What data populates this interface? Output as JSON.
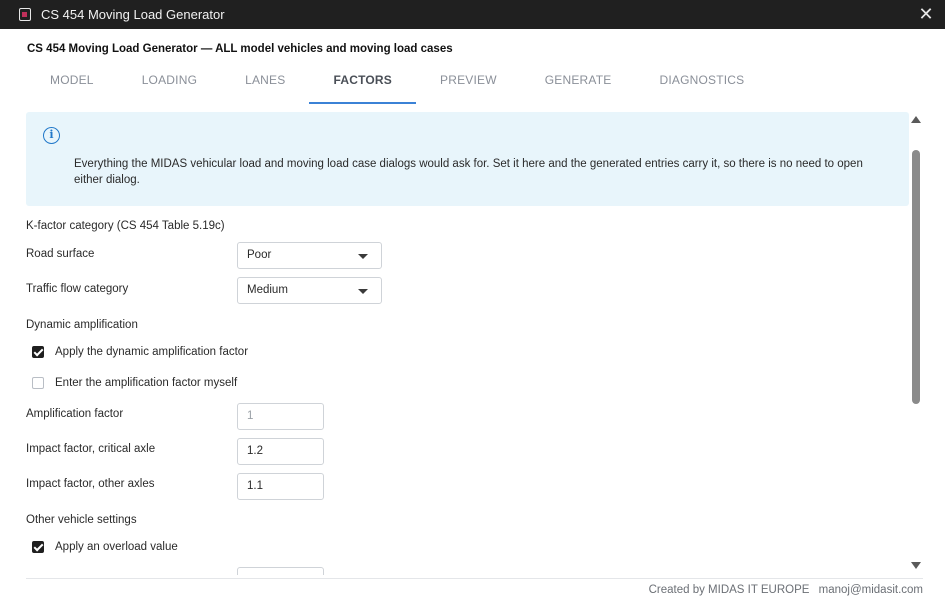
{
  "window": {
    "title": "CS 454 Moving Load Generator"
  },
  "page": {
    "heading": "CS 454 Moving Load Generator — ALL model vehicles and moving load cases"
  },
  "tabs": [
    {
      "label": "MODEL"
    },
    {
      "label": "LOADING"
    },
    {
      "label": "LANES"
    },
    {
      "label": "FACTORS"
    },
    {
      "label": "PREVIEW"
    },
    {
      "label": "GENERATE"
    },
    {
      "label": "DIAGNOSTICS"
    }
  ],
  "active_tab": "FACTORS",
  "info": {
    "icon": "info-circle-icon",
    "text": "Everything the MIDAS vehicular load and moving load case dialogs would ask for. Set it here and the generated entries carry it, so there is no need to open either dialog."
  },
  "kfactor": {
    "heading": "K-factor category (CS 454 Table 5.19c)",
    "road_surface": {
      "label": "Road surface",
      "value": "Poor"
    },
    "traffic_flow": {
      "label": "Traffic flow category",
      "value": "Medium"
    }
  },
  "dynamic": {
    "heading": "Dynamic amplification",
    "apply_daf": {
      "label": "Apply the dynamic amplification factor",
      "checked": true
    },
    "enter_myself": {
      "label": "Enter the amplification factor myself",
      "checked": false
    },
    "amplification_factor": {
      "label": "Amplification factor",
      "value": "1"
    },
    "impact_critical": {
      "label": "Impact factor, critical axle",
      "value": "1.2"
    },
    "impact_other": {
      "label": "Impact factor, other axles",
      "value": "1.1"
    }
  },
  "other": {
    "heading": "Other vehicle settings",
    "apply_overload": {
      "label": "Apply an overload value",
      "checked": true
    }
  },
  "footer": {
    "credit": "Created by MIDAS IT EUROPE",
    "email": "manoj@midasit.com"
  }
}
